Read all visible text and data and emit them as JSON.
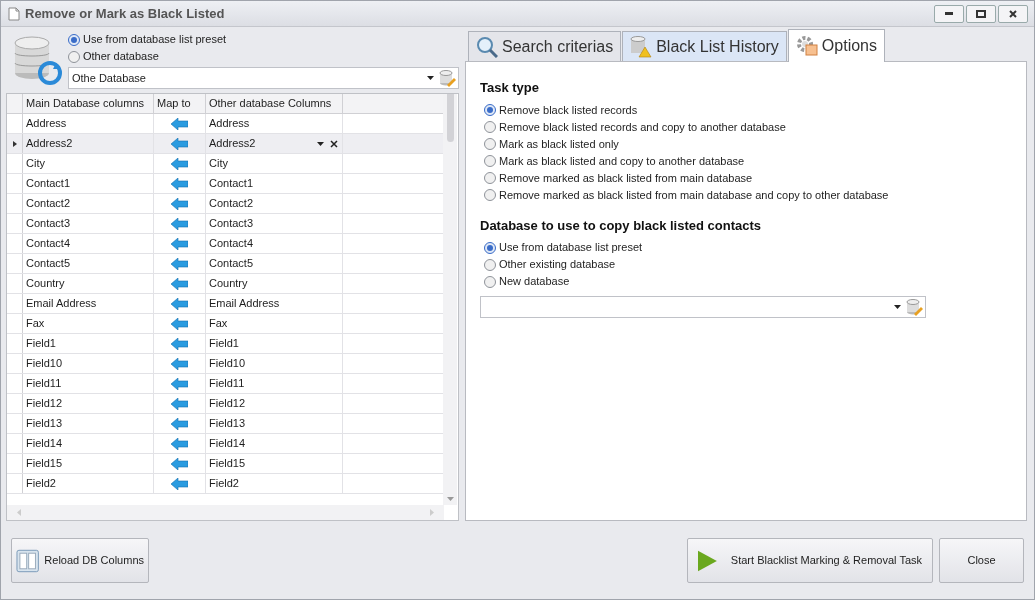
{
  "window": {
    "title": "Remove or Mark as Black Listed"
  },
  "source": {
    "options": [
      {
        "label": "Use from database list preset",
        "selected": true
      },
      {
        "label": "Other database",
        "selected": false
      }
    ],
    "database": "Othe Database"
  },
  "grid": {
    "columns": [
      "Main Database columns",
      "Map to",
      "Other database Columns"
    ],
    "rows": [
      {
        "main": "Address",
        "other": "Address",
        "selected": false
      },
      {
        "main": "Address2",
        "other": "Address2",
        "selected": true
      },
      {
        "main": "City",
        "other": "City",
        "selected": false
      },
      {
        "main": "Contact1",
        "other": "Contact1",
        "selected": false
      },
      {
        "main": "Contact2",
        "other": "Contact2",
        "selected": false
      },
      {
        "main": "Contact3",
        "other": "Contact3",
        "selected": false
      },
      {
        "main": "Contact4",
        "other": "Contact4",
        "selected": false
      },
      {
        "main": "Contact5",
        "other": "Contact5",
        "selected": false
      },
      {
        "main": "Country",
        "other": "Country",
        "selected": false
      },
      {
        "main": "Email Address",
        "other": "Email Address",
        "selected": false
      },
      {
        "main": "Fax",
        "other": "Fax",
        "selected": false
      },
      {
        "main": "Field1",
        "other": "Field1",
        "selected": false
      },
      {
        "main": "Field10",
        "other": "Field10",
        "selected": false
      },
      {
        "main": "Field11",
        "other": "Field11",
        "selected": false
      },
      {
        "main": "Field12",
        "other": "Field12",
        "selected": false
      },
      {
        "main": "Field13",
        "other": "Field13",
        "selected": false
      },
      {
        "main": "Field14",
        "other": "Field14",
        "selected": false
      },
      {
        "main": "Field15",
        "other": "Field15",
        "selected": false
      },
      {
        "main": "Field2",
        "other": "Field2",
        "selected": false
      }
    ]
  },
  "tabs": [
    {
      "label": "Search criterias",
      "selected": false,
      "kind": "search"
    },
    {
      "label": "Black List History",
      "selected": false,
      "kind": "history"
    },
    {
      "label": "Options",
      "selected": true,
      "kind": "options"
    }
  ],
  "task_type": {
    "heading": "Task type",
    "options": [
      {
        "label": "Remove black listed records",
        "selected": true
      },
      {
        "label": "Remove black listed records and copy to another database",
        "selected": false
      },
      {
        "label": "Mark as black listed only",
        "selected": false
      },
      {
        "label": "Mark as black listed and copy to another database",
        "selected": false
      },
      {
        "label": "Remove marked as black listed from main database",
        "selected": false
      },
      {
        "label": "Remove marked as black listed from main database and copy to other database",
        "selected": false
      }
    ]
  },
  "copy_target": {
    "heading": "Database to use to copy black listed contacts",
    "options": [
      {
        "label": "Use from database list preset",
        "selected": true
      },
      {
        "label": "Other existing database",
        "selected": false
      },
      {
        "label": "New database",
        "selected": false
      }
    ]
  },
  "buttons": {
    "reload": "Reload DB Columns",
    "start": "Start Blacklist Marking & Removal Task",
    "close": "Close"
  }
}
